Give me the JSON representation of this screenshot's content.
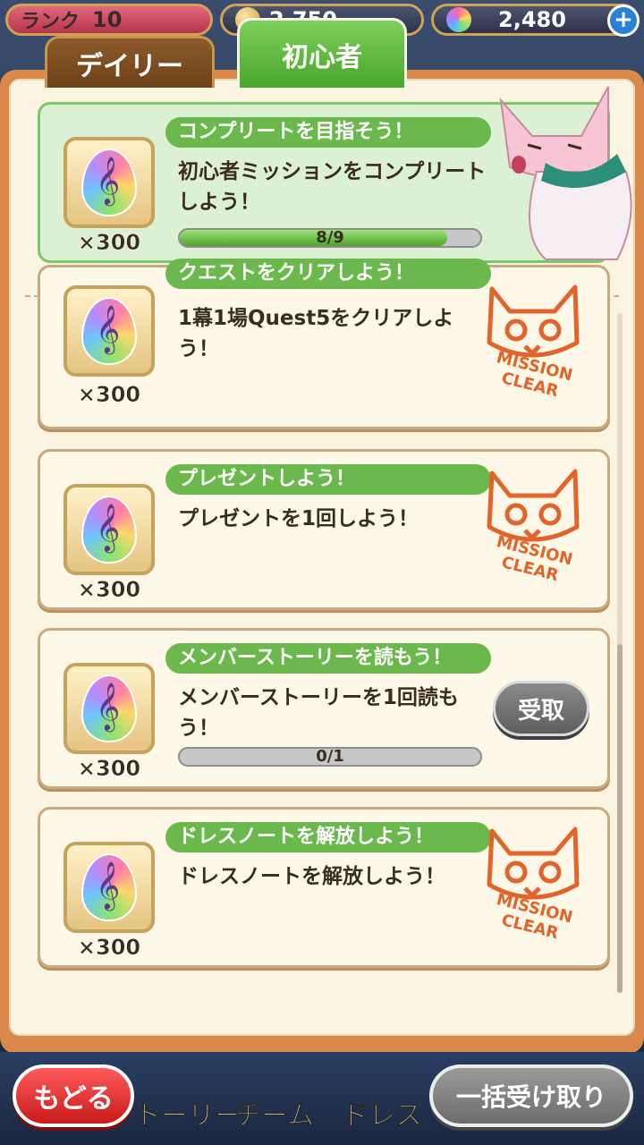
{
  "status_bar": {
    "rank_label": "ランク",
    "rank_value": "10",
    "coin_value": "2,750",
    "gem_value": "2,480",
    "plus_icon": "plus-icon"
  },
  "tabs": [
    {
      "label": "デイリー",
      "active": false
    },
    {
      "label": "初心者",
      "active": true
    }
  ],
  "missions": [
    {
      "title": "コンプリートを目指そう！",
      "description": "初心者ミッションをコンプリートしよう！",
      "reward_count": "×300",
      "progress_text": "8/9",
      "progress": 0.89,
      "highlight": true
    },
    {
      "title": "クエストをクリアしよう！",
      "description": "1幕1場Quest5をクリアしよう！",
      "reward_count": "×300",
      "stamp": "MISSION CLEAR"
    },
    {
      "title": "プレゼントしよう！",
      "description": "プレゼントを1回しよう！",
      "reward_count": "×300",
      "stamp": "MISSION CLEAR"
    },
    {
      "title": "メンバーストーリーを読もう！",
      "description": "メンバーストーリーを1回読もう！",
      "reward_count": "×300",
      "progress_text": "0/1",
      "progress": 0,
      "button_label": "受取"
    },
    {
      "title": "ドレスノートを解放しよう！",
      "description": "ドレスノートを解放しよう！",
      "reward_count": "×300",
      "stamp": "MISSION CLEAR"
    }
  ],
  "bottom_nav": {
    "back_label": "もどる",
    "story_label": "トーリー",
    "team_label": "チーム",
    "dress_label": "ドレス",
    "bulk_receive_label": "一括受け取り"
  },
  "colors": {
    "accent_green": "#6bb84d",
    "panel_orange": "#d9894a",
    "stamp_orange": "#e2642a"
  }
}
